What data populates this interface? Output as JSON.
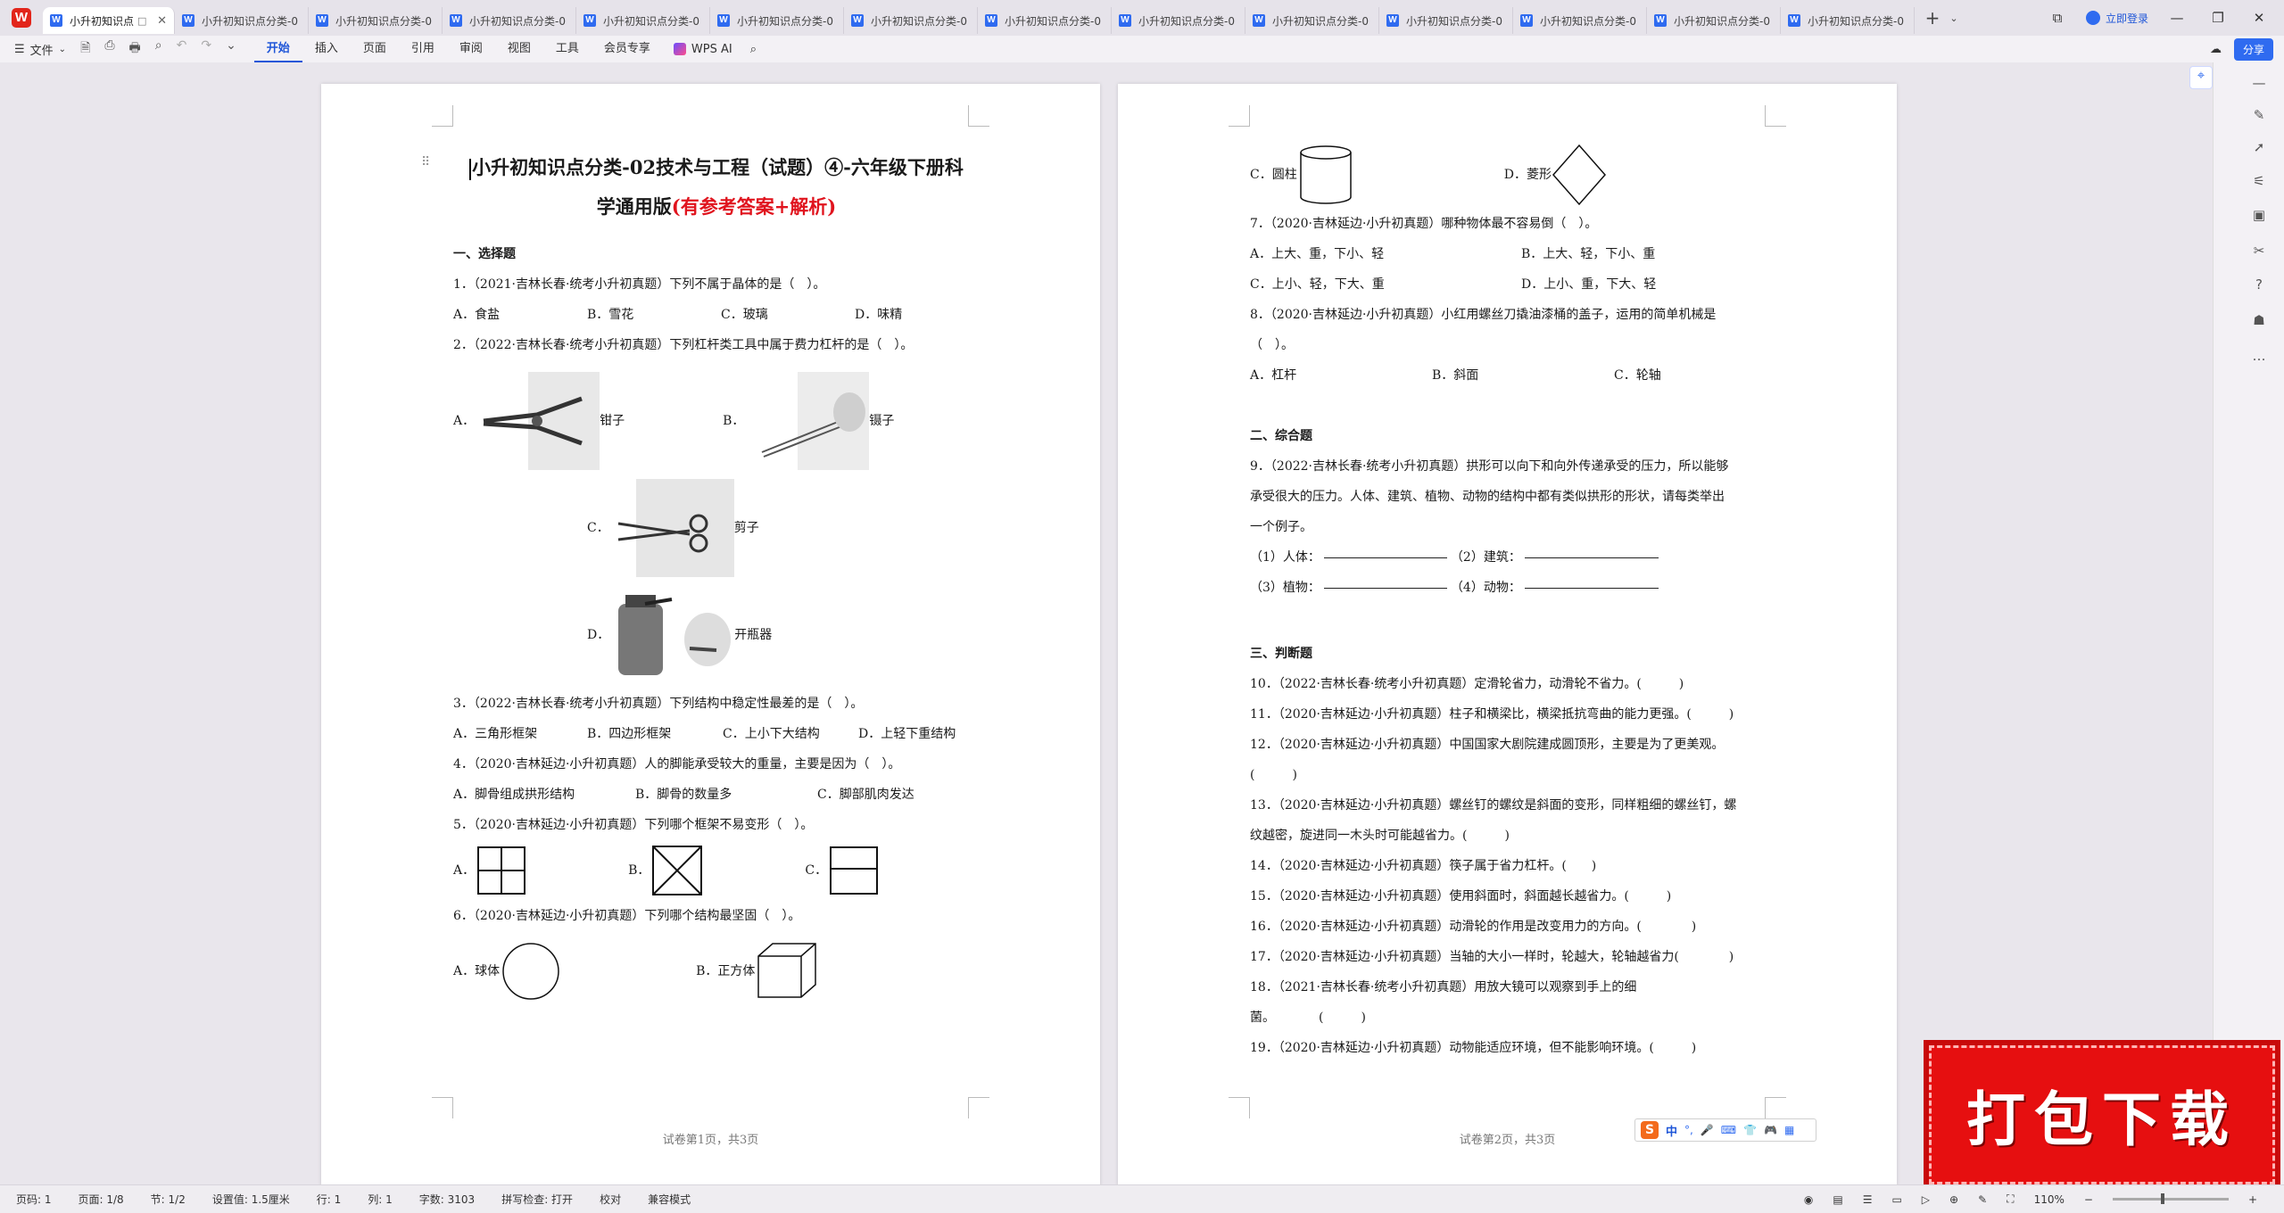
{
  "app": {
    "logo_letter": "W"
  },
  "tabs": [
    {
      "label": "小升初知识点",
      "active": true,
      "extra": "□"
    },
    {
      "label": "小升初知识点分类-0"
    },
    {
      "label": "小升初知识点分类-0"
    },
    {
      "label": "小升初知识点分类-0"
    },
    {
      "label": "小升初知识点分类-0"
    },
    {
      "label": "小升初知识点分类-0"
    },
    {
      "label": "小升初知识点分类-0"
    },
    {
      "label": "小升初知识点分类-0"
    },
    {
      "label": "小升初知识点分类-0"
    },
    {
      "label": "小升初知识点分类-0"
    },
    {
      "label": "小升初知识点分类-0"
    },
    {
      "label": "小升初知识点分类-0"
    },
    {
      "label": "小升初知识点分类-0"
    },
    {
      "label": "小升初知识点分类-0"
    }
  ],
  "titlebar": {
    "login": "立即登录",
    "add_tab": "+",
    "more": "⌄"
  },
  "ribbon": {
    "file": "文件",
    "tabs": [
      "开始",
      "插入",
      "页面",
      "引用",
      "审阅",
      "视图",
      "工具",
      "会员专享"
    ],
    "active_tab": "开始",
    "ai": "WPS AI",
    "share": "分享"
  },
  "page1": {
    "title_line1": "小升初知识点分类-02技术与工程（试题）④-六年级下册科",
    "title_line2": "学通用版",
    "title_red": "(有参考答案+解析)",
    "section1": "一、选择题",
    "q1": "1．（2021·吉林长春·统考小升初真题）下列不属于晶体的是（　）。",
    "q1_opts": [
      "A．食盐",
      "B．雪花",
      "C．玻璃",
      "D．味精"
    ],
    "q2": "2．（2022·吉林长春·统考小升初真题）下列杠杆类工具中属于费力杠杆的是（　）。",
    "q2_opts": [
      {
        "letter": "A．",
        "name": "钳子"
      },
      {
        "letter": "B．",
        "name": "镊子"
      },
      {
        "letter": "C．",
        "name": "剪子"
      },
      {
        "letter": "D．",
        "name": "开瓶器"
      }
    ],
    "q3": "3．（2022·吉林长春·统考小升初真题）下列结构中稳定性最差的是（　）。",
    "q3_opts": [
      "A．三角形框架",
      "B．四边形框架",
      "C．上小下大结构",
      "D．上轻下重结构"
    ],
    "q4": "4．（2020·吉林延边·小升初真题）人的脚能承受较大的重量，主要是因为（　）。",
    "q4_opts": [
      "A．脚骨组成拱形结构",
      "B．脚骨的数量多",
      "C．脚部肌肉发达"
    ],
    "q5": "5．（2020·吉林延边·小升初真题）下列哪个框架不易变形（　）。",
    "q5_opts": [
      "A．",
      "B．",
      "C．"
    ],
    "q6": "6．（2020·吉林延边·小升初真题）下列哪个结构最坚固（　）。",
    "q6_opts": [
      "A．球体",
      "B．正方体"
    ],
    "footer": "试卷第1页，共3页"
  },
  "page2": {
    "q6_opts": [
      "C．圆柱",
      "D．菱形"
    ],
    "q7": "7．（2020·吉林延边·小升初真题）哪种物体最不容易倒（　）。",
    "q7_opts": [
      "A．上大、重，下小、轻",
      "B．上大、轻，下小、重",
      "C．上小、轻，下大、重",
      "D．上小、重，下大、轻"
    ],
    "q8_a": "8．（2020·吉林延边·小升初真题）小红用螺丝刀撬油漆桶的盖子，运用的简单机械是",
    "q8_b": "（　）。",
    "q8_opts": [
      "A．杠杆",
      "B．斜面",
      "C．轮轴"
    ],
    "section2": "二、综合题",
    "q9_a": "9．（2022·吉林长春·统考小升初真题）拱形可以向下和向外传递承受的压力，所以能够",
    "q9_b": "承受很大的压力。人体、建筑、植物、动物的结构中都有类似拱形的形状，请每类举出",
    "q9_c": "一个例子。",
    "q9_fill": [
      "（1）人体：",
      "（2）建筑：",
      "（3）植物：",
      "（4）动物："
    ],
    "section3": "三、判断题",
    "q10": "10．（2022·吉林长春·统考小升初真题）定滑轮省力，动滑轮不省力。(　　　)",
    "q11": "11．（2020·吉林延边·小升初真题）柱子和横梁比，横梁抵抗弯曲的能力更强。(　　　)",
    "q12_a": "12．（2020·吉林延边·小升初真题）中国国家大剧院建成圆顶形，主要是为了更美观。",
    "q12_b": "(　　　)",
    "q13_a": "13．（2020·吉林延边·小升初真题）螺丝钉的螺纹是斜面的变形，同样粗细的螺丝钉，螺",
    "q13_b": "纹越密，旋进同一木头时可能越省力。(　　　)",
    "q14": "14．（2020·吉林延边·小升初真题）筷子属于省力杠杆。(　　)",
    "q15": "15．（2020·吉林延边·小升初真题）使用斜面时，斜面越长越省力。(　　　)",
    "q16": "16．（2020·吉林延边·小升初真题）动滑轮的作用是改变用力的方向。(　　　　)",
    "q17": "17．（2020·吉林延边·小升初真题）当轴的大小一样时，轮越大，轮轴越省力(　　　　)",
    "q18_a": "18．（2021·吉林长春·统考小升初真题）用放大镜可以观察到手上的细",
    "q18_b": "菌。　　　　(　　　)",
    "q19": "19．（2020·吉林延边·小升初真题）动物能适应环境，但不能影响环境。(　　　)",
    "footer": "试卷第2页，共3页"
  },
  "ime": {
    "logo": "S",
    "mode": "中",
    "punct": "°,"
  },
  "banner": {
    "text": "打包下载"
  },
  "status": {
    "page_no": "页码: 1",
    "pages": "页面: 1/8",
    "section": "节: 1/2",
    "setting": "设置值: 1.5厘米",
    "row": "行: 1",
    "col": "列: 1",
    "words": "字数: 3103",
    "spell": "拼写检查: 打开",
    "proof": "校对",
    "compat": "兼容模式",
    "zoom": "110%"
  },
  "colors": {
    "accent": "#1f56d8",
    "red": "#e0141e",
    "banner": "#e60f10"
  }
}
